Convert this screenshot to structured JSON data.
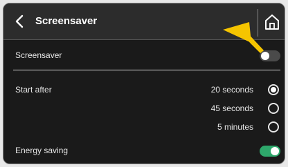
{
  "header": {
    "title": "Screensaver",
    "back_icon": "chevron-left-icon",
    "home_icon": "home-icon"
  },
  "screensaver": {
    "label": "Screensaver",
    "enabled": false
  },
  "start_after": {
    "label": "Start after",
    "options": [
      {
        "label": "20 seconds",
        "selected": true
      },
      {
        "label": "45 seconds",
        "selected": false
      },
      {
        "label": "5 minutes",
        "selected": false
      }
    ]
  },
  "energy_saving": {
    "label": "Energy saving",
    "enabled": true
  },
  "colors": {
    "background": "#1a1a1a",
    "toggle_on": "#2ea86b",
    "toggle_off": "#4a4a4a",
    "pointer": "#f5c400"
  }
}
